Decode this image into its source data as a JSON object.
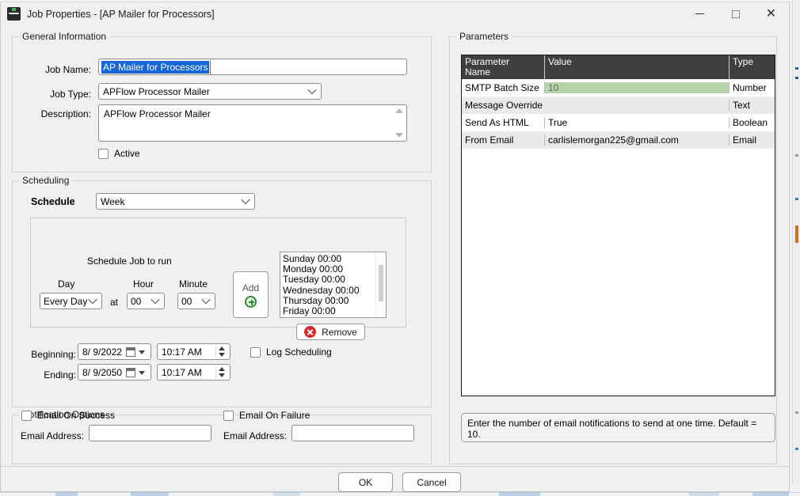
{
  "window": {
    "title": "Job Properties - [AP Mailer for Processors]",
    "app_icon": "job-properties-icon",
    "minimize_label": "Minimize",
    "maximize_label": "Maximize",
    "close_label": "Close"
  },
  "general": {
    "legend": "General Information",
    "job_name_label": "Job Name:",
    "job_name_value": "AP Mailer for Processors",
    "job_type_label": "Job Type:",
    "job_type_value": "APFlow Processor Mailer",
    "description_label": "Description:",
    "description_value": "APFlow Processor Mailer",
    "active_label": "Active",
    "active_checked": false
  },
  "scheduling": {
    "legend": "Scheduling",
    "schedule_label": "Schedule",
    "schedule_value": "Week",
    "panel_title": "Schedule Job to run",
    "day_label": "Day",
    "day_value": "Every Day",
    "at_label": "at",
    "hour_label": "Hour",
    "hour_value": "00",
    "minute_label": "Minute",
    "minute_value": "00",
    "add_label": "Add",
    "add_icon": "circle-plus-icon",
    "remove_label": "Remove",
    "remove_icon": "circle-x-icon",
    "entries": [
      "Sunday 00:00",
      "Monday 00:00",
      "Tuesday 00:00",
      "Wednesday 00:00",
      "Thursday 00:00",
      "Friday 00:00"
    ],
    "beginning_label": "Beginning:",
    "beginning_date": "8/  9/2022",
    "beginning_time": "10:17 AM",
    "ending_label": "Ending:",
    "ending_date": "8/  9/2050",
    "ending_time": "10:17 AM",
    "log_scheduling_label": "Log Scheduling",
    "log_scheduling_checked": false
  },
  "notifications": {
    "legend": "Notification Options",
    "success_checkbox_label": "Email On Success",
    "success_email_label": "Email Address:",
    "success_email_value": "",
    "failure_checkbox_label": "Email On Failure",
    "failure_email_label": "Email Address:",
    "failure_email_value": ""
  },
  "parameters": {
    "legend": "Parameters",
    "columns": [
      "Parameter Name",
      "Value",
      "Type"
    ],
    "column_name_line1": "Parameter",
    "column_name_line2": "Name",
    "rows": [
      {
        "name": "SMTP Batch Size",
        "value": "10",
        "type": "Number"
      },
      {
        "name": "Message Override",
        "value": "",
        "type": "Text"
      },
      {
        "name": "Send As HTML",
        "value": "True",
        "type": "Boolean"
      },
      {
        "name": "From Email",
        "value": "carlislemorgan225@gmail.com",
        "type": "Email"
      }
    ],
    "hint": "Enter the number of email notifications to send at one time. Default = 10."
  },
  "footer": {
    "ok_label": "OK",
    "cancel_label": "Cancel"
  },
  "colors": {
    "selection_blue": "#1565d8",
    "selected_cell_green": "#b6d3ab",
    "header_gray": "#3f3f3f",
    "add_green": "#2e8b2e",
    "remove_red": "#d42a2a"
  }
}
